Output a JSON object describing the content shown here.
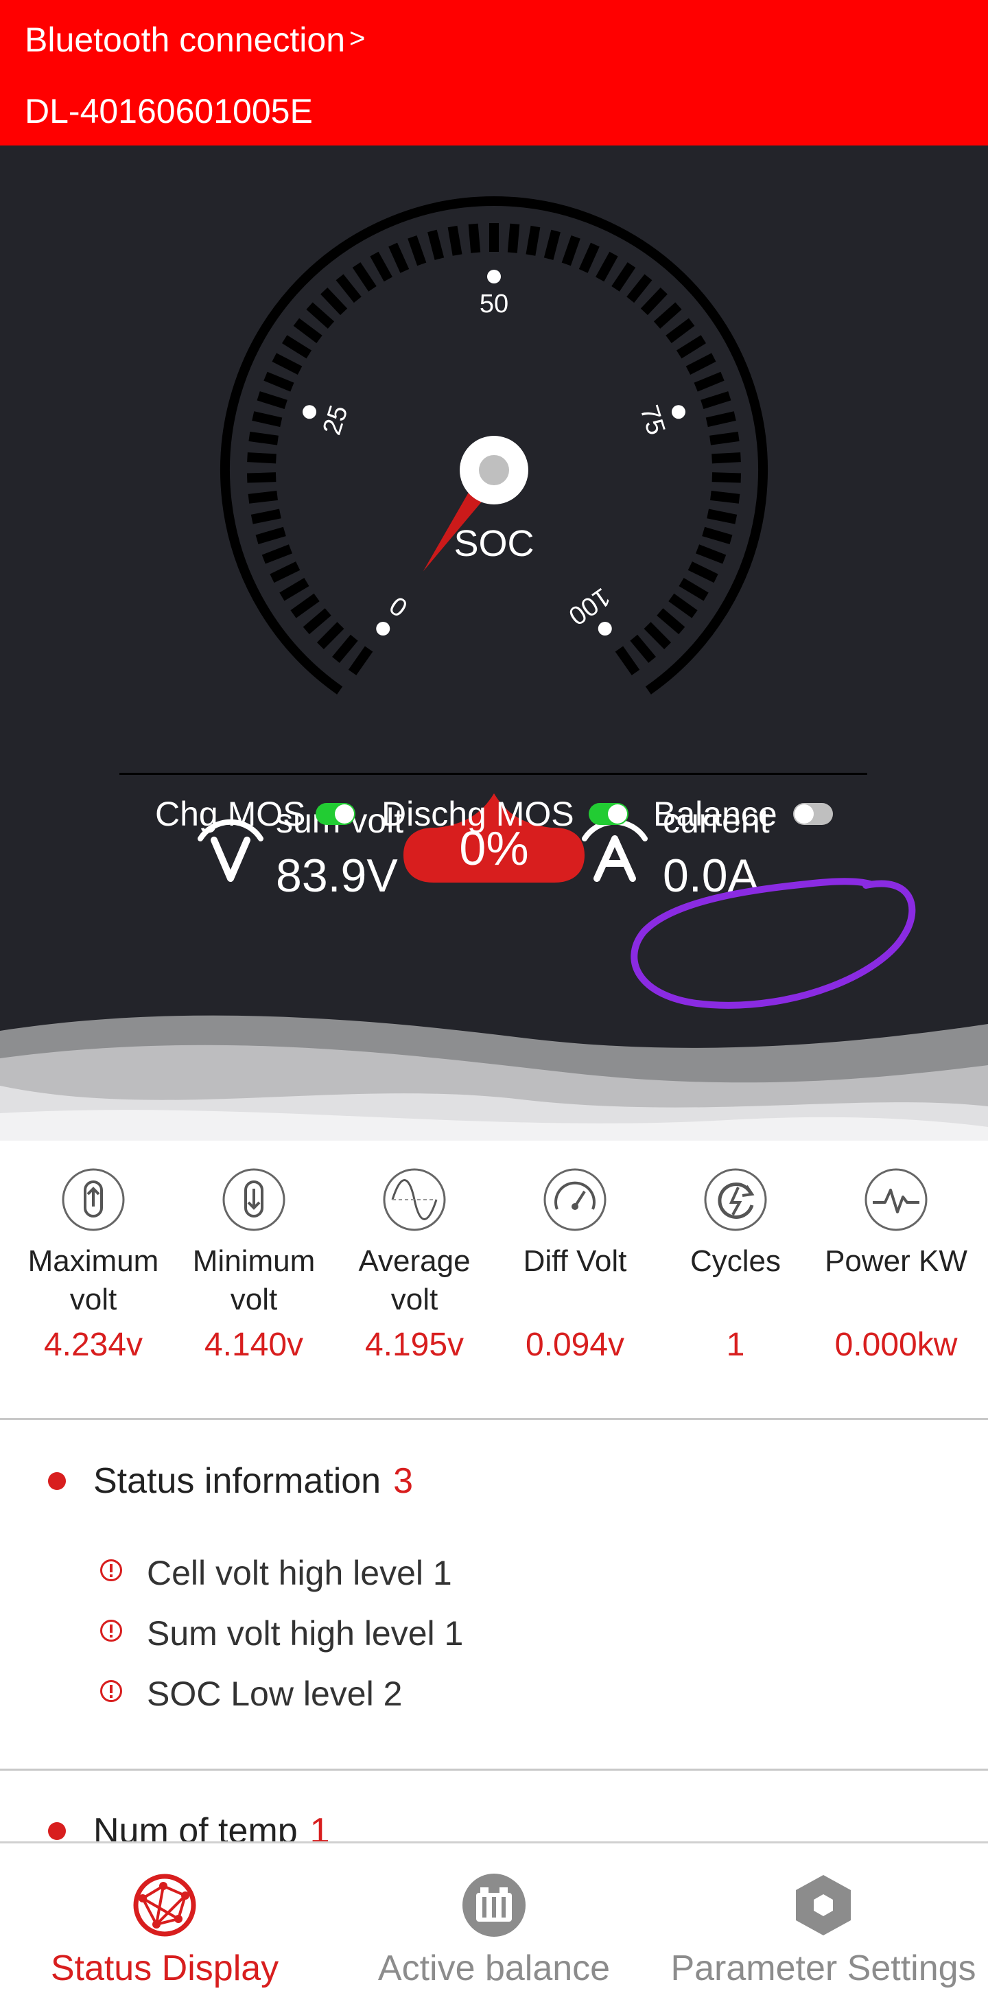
{
  "header": {
    "bluetooth_label": "Bluetooth connection",
    "chevron": ">",
    "device_id": "DL-40160601005E"
  },
  "gauge": {
    "ticks": [
      "0",
      "25",
      "50",
      "75",
      "100"
    ],
    "label": "SOC",
    "value_text": "0%",
    "soc_value": 0
  },
  "metrics": {
    "sum_volt": {
      "label": "sum volt",
      "value": "83.9V"
    },
    "current": {
      "label": "current",
      "value": "0.0A"
    }
  },
  "switches": {
    "chg_mos": {
      "label": "Chg MOS",
      "on": true
    },
    "dischg_mos": {
      "label": "Dischg MOS",
      "on": true
    },
    "balance": {
      "label": "Balance",
      "on": false
    }
  },
  "stats": [
    {
      "label_line1": "Maximum",
      "label_line2": "volt",
      "value": "4.234v",
      "icon": "max-volt-icon"
    },
    {
      "label_line1": "Minimum",
      "label_line2": "volt",
      "value": "4.140v",
      "icon": "min-volt-icon"
    },
    {
      "label_line1": "Average",
      "label_line2": "volt",
      "value": "4.195v",
      "icon": "avg-volt-icon"
    },
    {
      "label_line1": "Diff Volt",
      "label_line2": "",
      "value": "0.094v",
      "icon": "diff-volt-gauge-icon"
    },
    {
      "label_line1": "Cycles",
      "label_line2": "",
      "value": "1",
      "icon": "cycles-icon"
    },
    {
      "label_line1": "Power KW",
      "label_line2": "",
      "value": "0.000kw",
      "icon": "power-pulse-icon"
    }
  ],
  "status_info": {
    "title": "Status information",
    "count": "3",
    "items": [
      "Cell volt high level 1",
      "Sum volt high level 1",
      "SOC Low level 2"
    ]
  },
  "temp_section": {
    "title": "Num of temp",
    "count": "1"
  },
  "nav": {
    "items": [
      {
        "label": "Status Display",
        "active": true,
        "icon": "globe-network-icon"
      },
      {
        "label": "Active balance",
        "active": false,
        "icon": "battery-pack-icon"
      },
      {
        "label": "Parameter Settings",
        "active": false,
        "icon": "settings-hexagon-icon"
      }
    ]
  },
  "colors": {
    "header_red": "#ff0000",
    "panel_dark": "#23242a",
    "accent_red": "#d81e1e",
    "toggle_green": "#22cc33",
    "annotation_purple": "#8a2be2",
    "nav_inactive": "#8c8c8c"
  }
}
